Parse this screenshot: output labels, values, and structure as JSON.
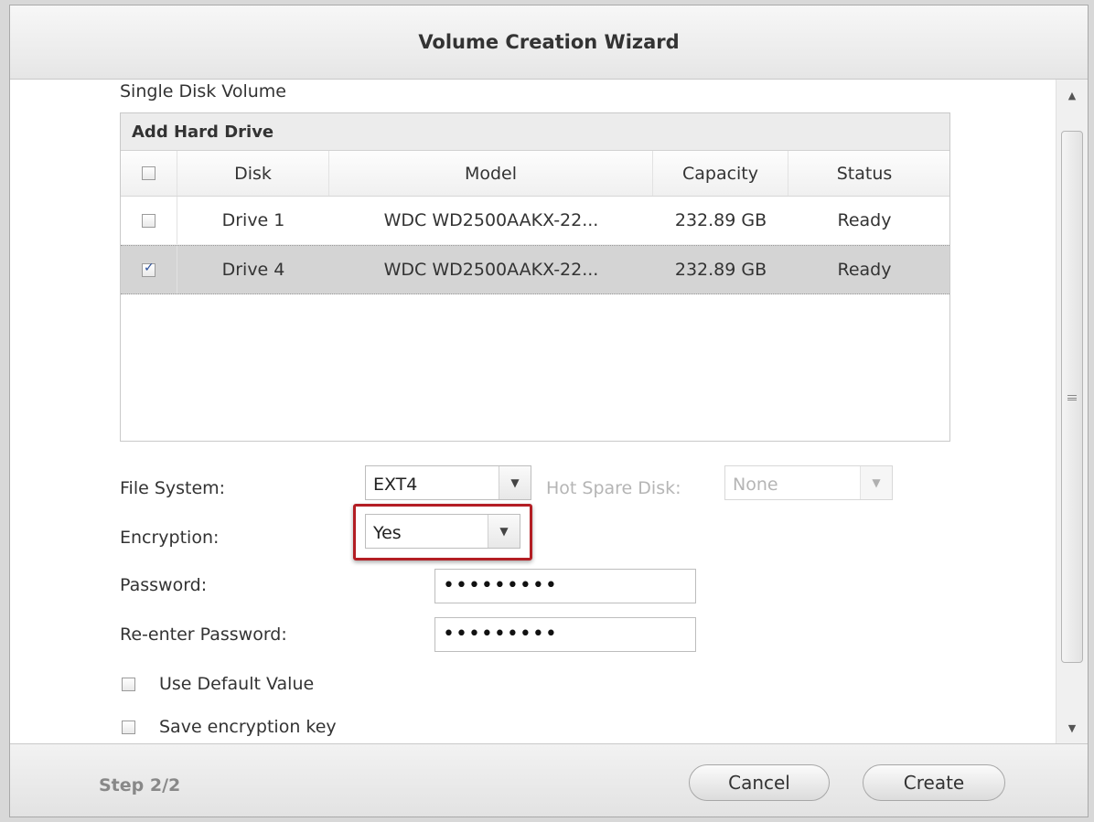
{
  "window": {
    "title": "Volume Creation Wizard"
  },
  "section_title": "Single Disk Volume",
  "disk_grid": {
    "title": "Add Hard Drive",
    "columns": [
      "Disk",
      "Model",
      "Capacity",
      "Status"
    ],
    "header_checkbox_checked": false,
    "rows": [
      {
        "checked": false,
        "disk": "Drive 1",
        "model": "WDC WD2500AAKX-22...",
        "capacity": "232.89 GB",
        "status": "Ready"
      },
      {
        "checked": true,
        "disk": "Drive 4",
        "model": "WDC WD2500AAKX-22...",
        "capacity": "232.89 GB",
        "status": "Ready"
      }
    ]
  },
  "form": {
    "file_system_label": "File System:",
    "file_system_value": "EXT4",
    "hot_spare_label": "Hot Spare Disk:",
    "hot_spare_value": "None",
    "encryption_label": "Encryption:",
    "encryption_value": "Yes",
    "password_label": "Password:",
    "password_value": "•••••••••",
    "reenter_label": "Re-enter Password:",
    "reenter_value": "•••••••••",
    "use_default_label": "Use Default Value",
    "save_key_label": "Save encryption key"
  },
  "footer": {
    "step": "Step 2/2",
    "cancel_label": "Cancel",
    "create_label": "Create"
  },
  "colors": {
    "highlight_border": "#b31e24",
    "selected_row": "#d4d4d4"
  }
}
